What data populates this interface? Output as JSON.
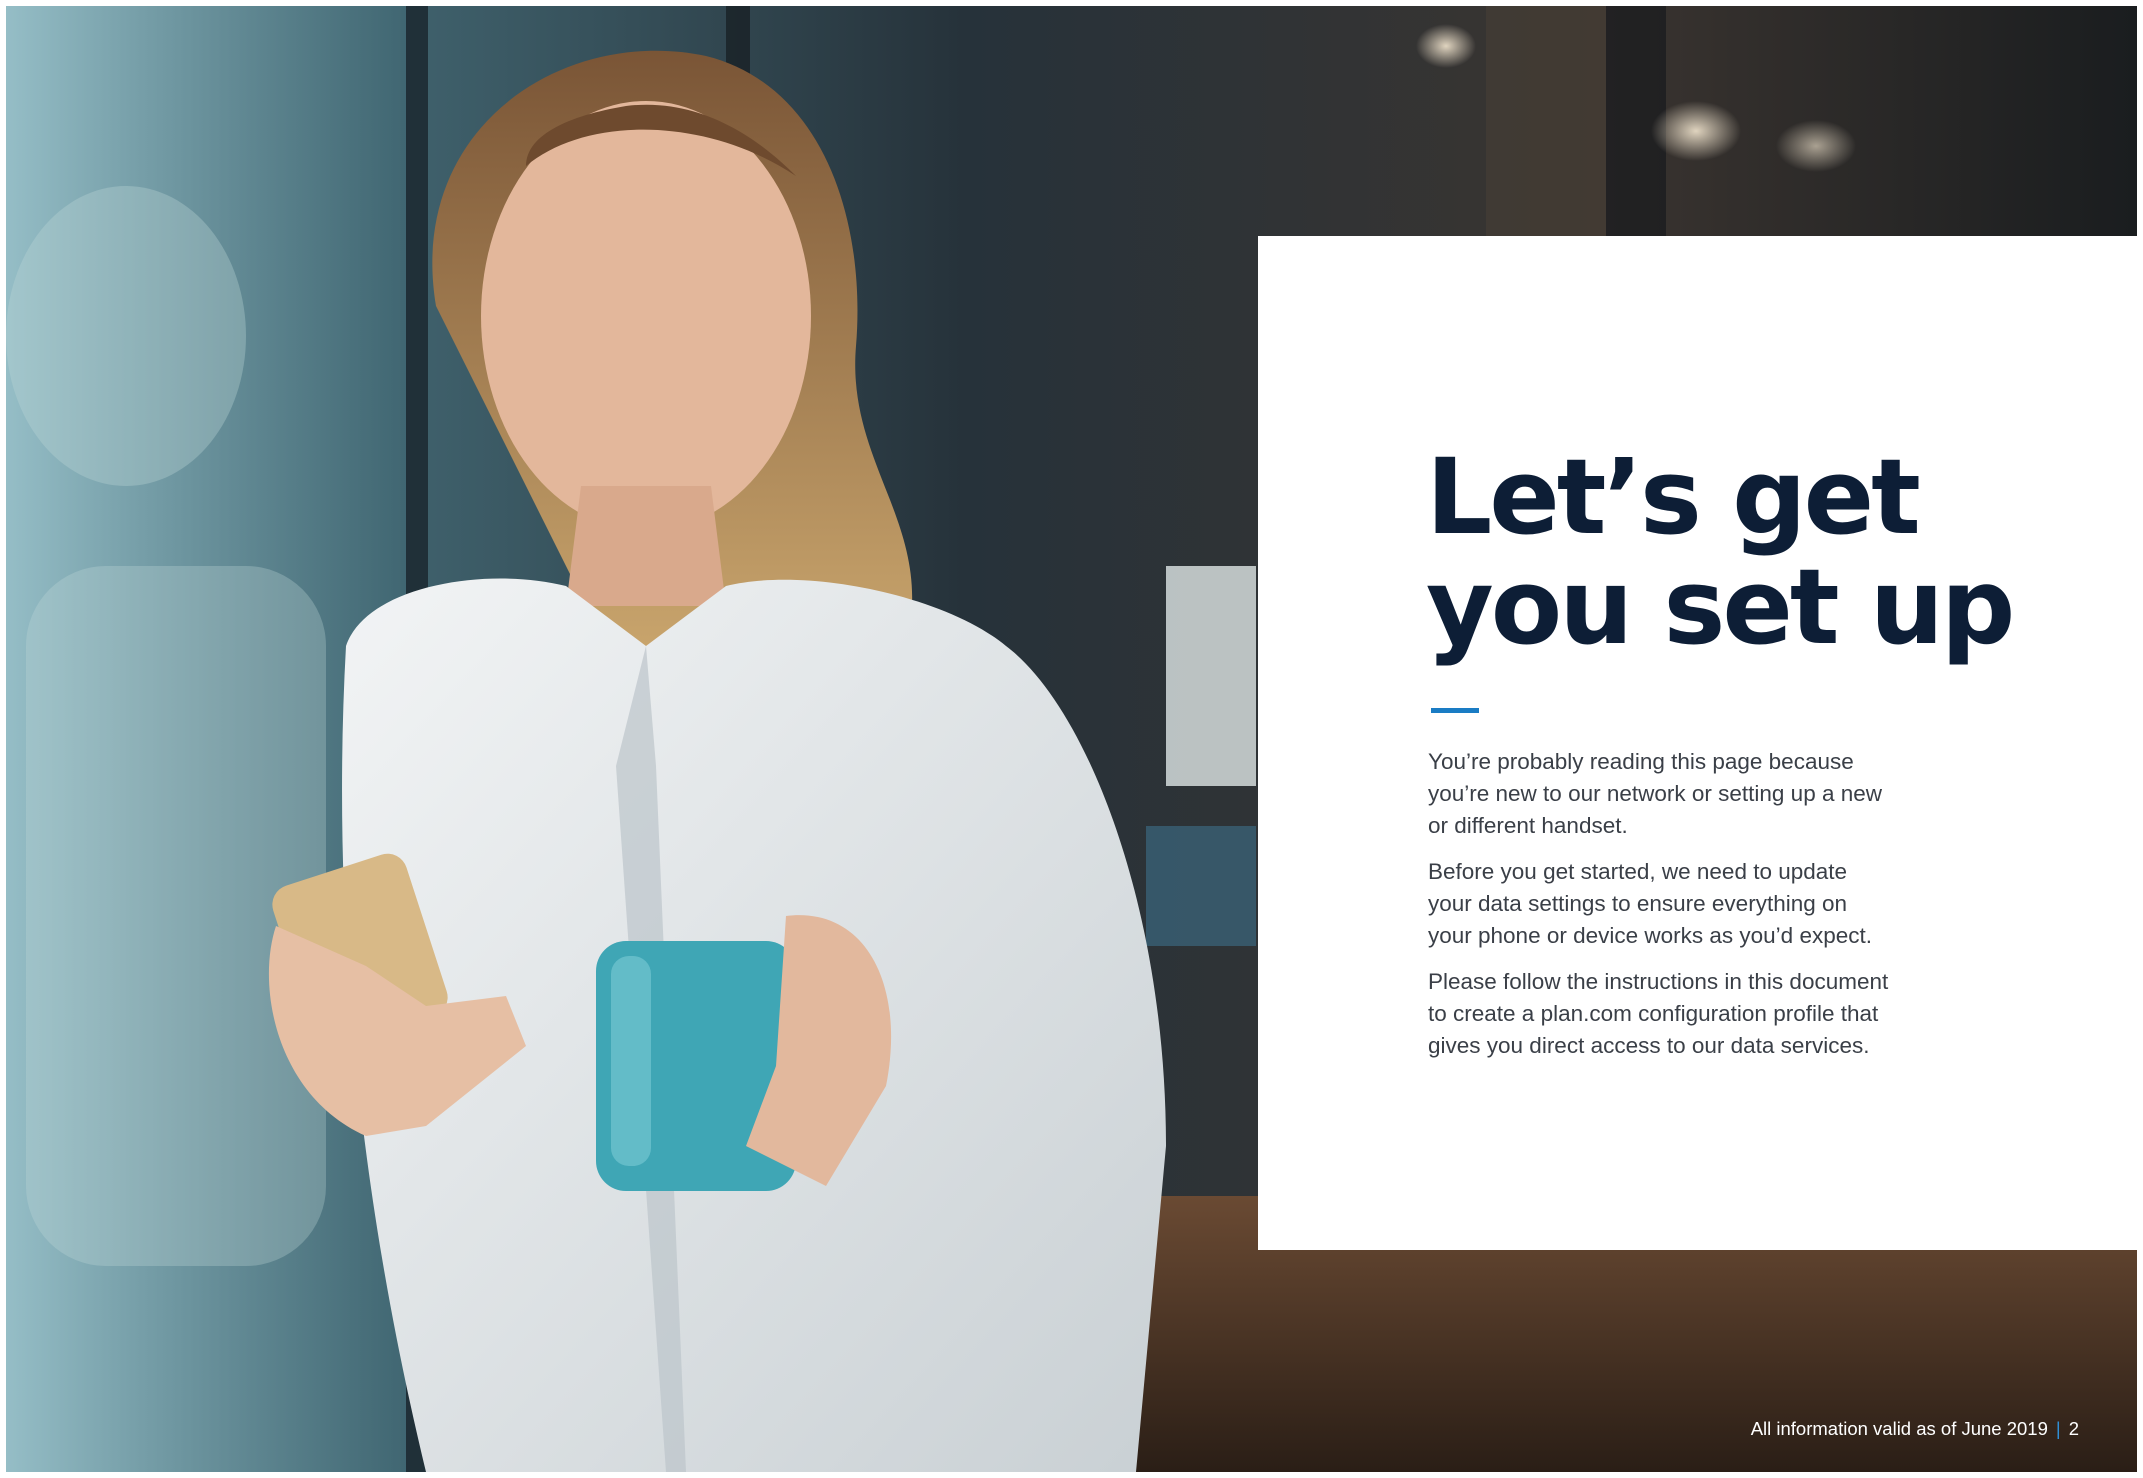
{
  "hero_photo": {
    "description_icon": "photo-woman-with-phone-and-mug"
  },
  "card": {
    "headline_line1": "Let’s get",
    "headline_line2": "you set up",
    "paragraphs": [
      {
        "lines": [
          "You’re probably reading this page because",
          "you’re new to our network or setting up a new",
          "or different handset."
        ]
      },
      {
        "lines": [
          "Before you get started, we need to update",
          "your data settings to ensure everything on",
          "your phone or device works as you’d expect."
        ]
      },
      {
        "lines": [
          "Please follow the instructions in this document",
          "to create a plan.com configuration profile that",
          "gives you direct access to our data services."
        ]
      }
    ]
  },
  "footer": {
    "validity_note": "All information valid as of June 2019",
    "separator": "|",
    "page_number": "2"
  },
  "colors": {
    "headline": "#0d1e36",
    "accent": "#1a7cc4",
    "body_text": "#3a3f47"
  }
}
